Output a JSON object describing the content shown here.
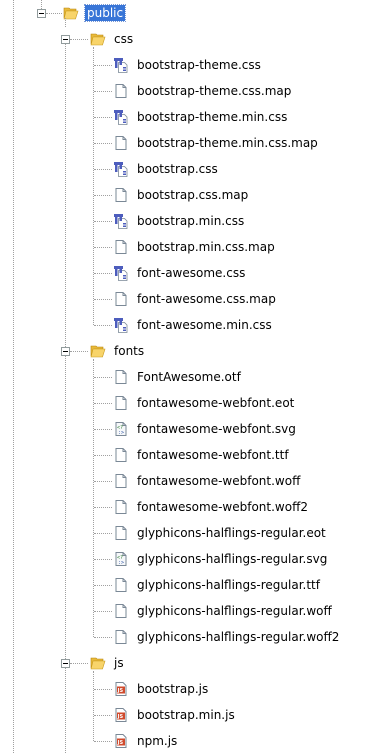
{
  "tree": {
    "root": {
      "label": "public",
      "icon": "folder-open-icon",
      "selected": true
    },
    "folders": [
      {
        "key": "css",
        "label": "css",
        "icon": "folder-open-icon",
        "files": [
          {
            "label": "bootstrap-theme.css",
            "icon": "css-file-icon"
          },
          {
            "label": "bootstrap-theme.css.map",
            "icon": "text-file-icon"
          },
          {
            "label": "bootstrap-theme.min.css",
            "icon": "css-file-icon"
          },
          {
            "label": "bootstrap-theme.min.css.map",
            "icon": "text-file-icon"
          },
          {
            "label": "bootstrap.css",
            "icon": "css-file-icon"
          },
          {
            "label": "bootstrap.css.map",
            "icon": "text-file-icon"
          },
          {
            "label": "bootstrap.min.css",
            "icon": "css-file-icon"
          },
          {
            "label": "bootstrap.min.css.map",
            "icon": "text-file-icon"
          },
          {
            "label": "font-awesome.css",
            "icon": "css-file-icon"
          },
          {
            "label": "font-awesome.css.map",
            "icon": "text-file-icon"
          },
          {
            "label": "font-awesome.min.css",
            "icon": "css-file-icon"
          }
        ]
      },
      {
        "key": "fonts",
        "label": "fonts",
        "icon": "folder-open-icon",
        "files": [
          {
            "label": "FontAwesome.otf",
            "icon": "text-file-icon"
          },
          {
            "label": "fontawesome-webfont.eot",
            "icon": "text-file-icon"
          },
          {
            "label": "fontawesome-webfont.svg",
            "icon": "svg-file-icon"
          },
          {
            "label": "fontawesome-webfont.ttf",
            "icon": "text-file-icon"
          },
          {
            "label": "fontawesome-webfont.woff",
            "icon": "text-file-icon"
          },
          {
            "label": "fontawesome-webfont.woff2",
            "icon": "text-file-icon"
          },
          {
            "label": "glyphicons-halflings-regular.eot",
            "icon": "text-file-icon"
          },
          {
            "label": "glyphicons-halflings-regular.svg",
            "icon": "svg-file-icon"
          },
          {
            "label": "glyphicons-halflings-regular.ttf",
            "icon": "text-file-icon"
          },
          {
            "label": "glyphicons-halflings-regular.woff",
            "icon": "text-file-icon"
          },
          {
            "label": "glyphicons-halflings-regular.woff2",
            "icon": "text-file-icon"
          }
        ]
      },
      {
        "key": "js",
        "label": "js",
        "icon": "folder-open-icon",
        "files": [
          {
            "label": "bootstrap.js",
            "icon": "js-file-icon"
          },
          {
            "label": "bootstrap.min.js",
            "icon": "js-file-icon"
          },
          {
            "label": "npm.js",
            "icon": "js-file-icon"
          }
        ]
      }
    ]
  },
  "colors": {
    "selection": "#3875d7",
    "folder": "#f5c451",
    "css_icon": "#4d5dbd",
    "js_icon": "#d04a2c"
  }
}
